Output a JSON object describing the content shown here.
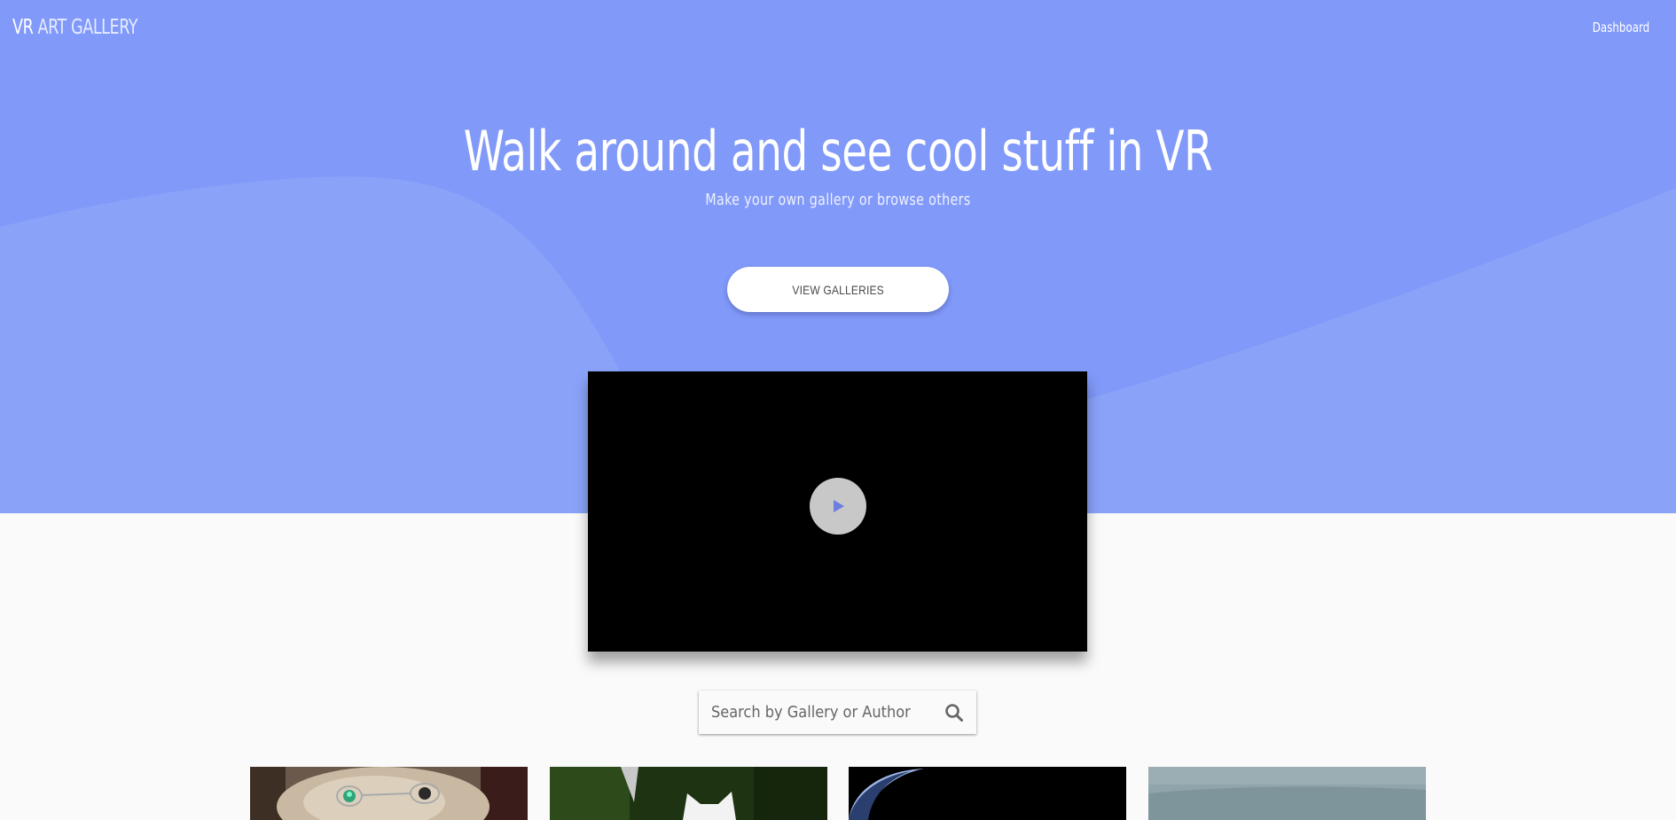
{
  "brand": {
    "prefix": "VR",
    "suffix": " ART GALLERY"
  },
  "nav": {
    "dashboard": "Dashboard"
  },
  "hero": {
    "title": "Walk around and see cool stuff in VR",
    "subtitle": "Make your own gallery or browse others",
    "cta_label": "VIEW GALLERIES",
    "background_color": "#8199f9"
  },
  "video": {
    "play_icon": "play-icon"
  },
  "search": {
    "placeholder": "Search by Gallery or Author",
    "value": "",
    "icon": "search-icon"
  },
  "gallery_cards": [
    {
      "name": "gallery-card-1"
    },
    {
      "name": "gallery-card-2"
    },
    {
      "name": "gallery-card-3"
    },
    {
      "name": "gallery-card-4"
    }
  ]
}
